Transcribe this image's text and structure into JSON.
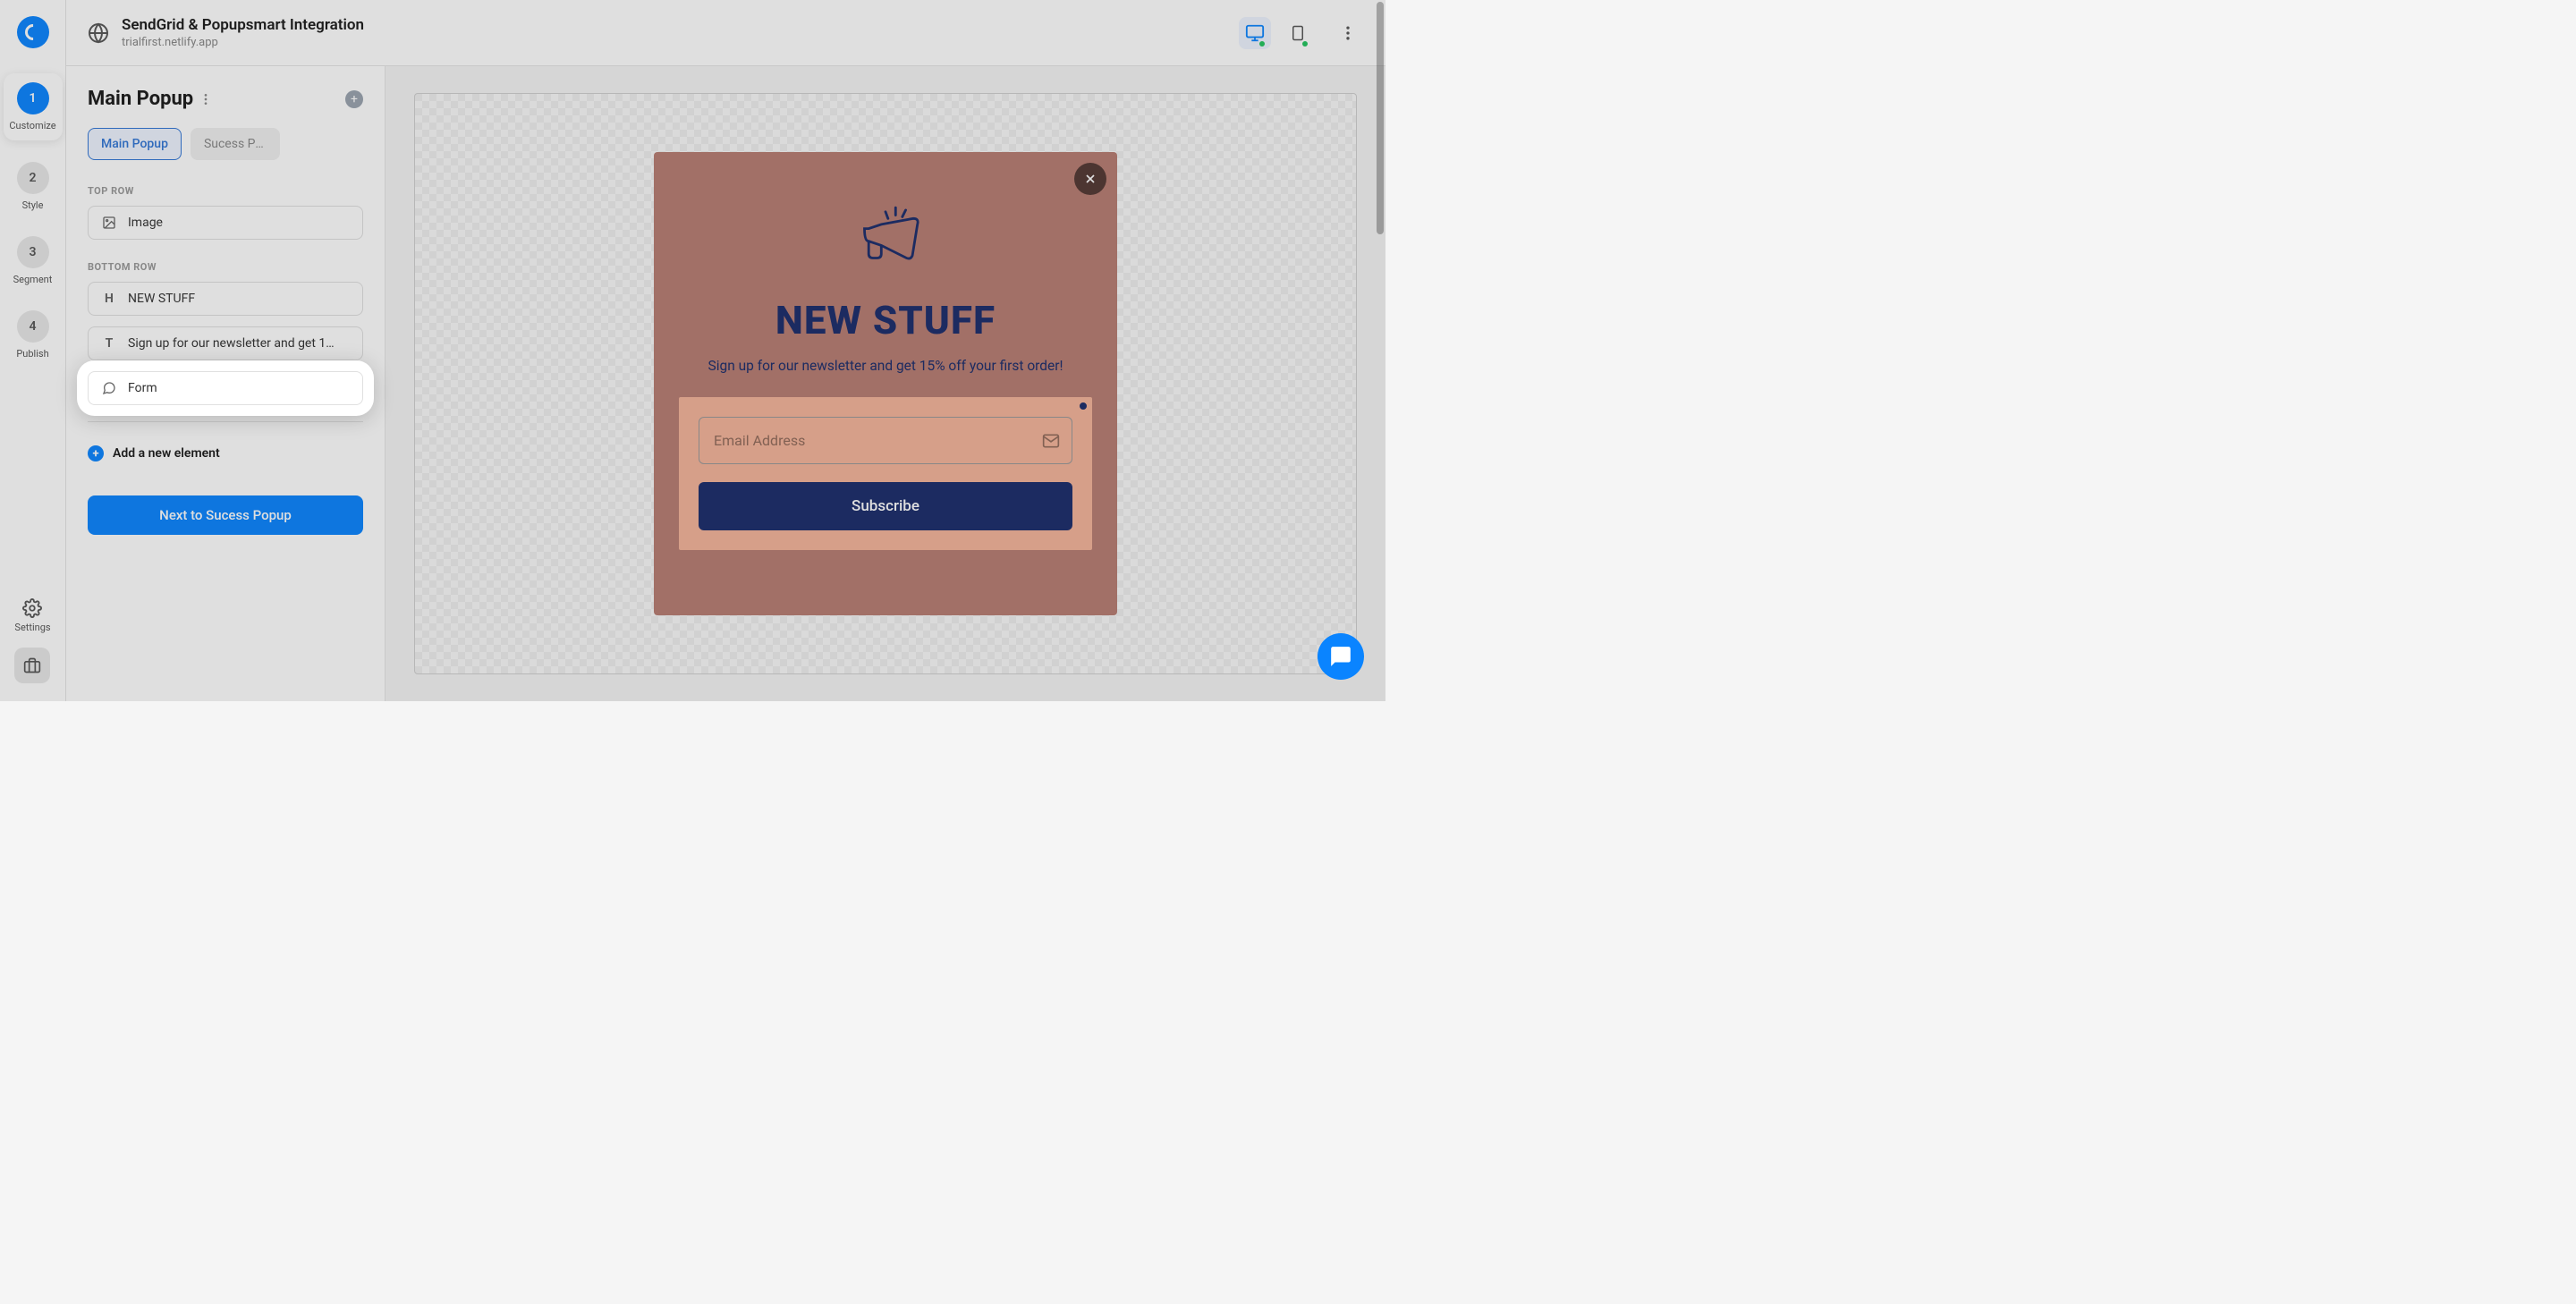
{
  "header": {
    "title": "SendGrid & Popupsmart Integration",
    "domain": "trialfirst.netlify.app"
  },
  "steps": [
    {
      "num": "1",
      "label": "Customize",
      "active": true
    },
    {
      "num": "2",
      "label": "Style",
      "active": false
    },
    {
      "num": "3",
      "label": "Segment",
      "active": false
    },
    {
      "num": "4",
      "label": "Publish",
      "active": false
    }
  ],
  "settings_label": "Settings",
  "panel": {
    "title": "Main Popup",
    "tabs": [
      {
        "label": "Main Popup",
        "active": true
      },
      {
        "label": "Sucess Pop…",
        "active": false
      }
    ],
    "sections": {
      "top_label": "TOP ROW",
      "bottom_label": "BOTTOM ROW"
    },
    "top_row": [
      {
        "icon": "image",
        "label": "Image"
      }
    ],
    "bottom_row": [
      {
        "icon": "H",
        "label": "NEW STUFF"
      },
      {
        "icon": "T",
        "label": "Sign up for our newsletter and get 1…"
      },
      {
        "icon": "form",
        "label": "Form",
        "highlighted": true
      }
    ],
    "add_element": "Add a new element",
    "next_button": "Next to Sucess Popup"
  },
  "popup_preview": {
    "headline": "NEW STUFF",
    "subtext": "Sign up for our newsletter and get 15% off your first order!",
    "email_placeholder": "Email Address",
    "subscribe_label": "Subscribe"
  }
}
